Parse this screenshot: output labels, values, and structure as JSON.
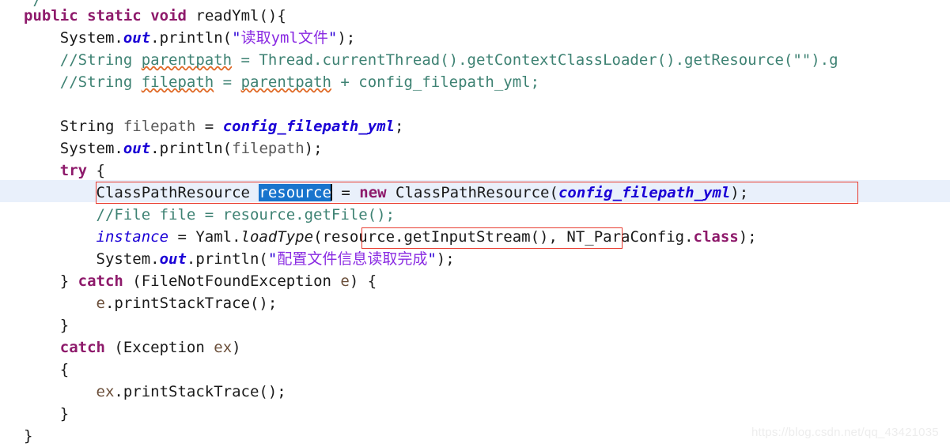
{
  "editor": {
    "language": "Java",
    "font_size_px": 19,
    "line_height_px": 28,
    "background": "#ffffff",
    "current_line_highlight": "#e9f0fb",
    "selection_color": "#1874cd",
    "annotation_box_color": "#e83b2f",
    "colors": {
      "keyword": "#8e1a6b",
      "comment": "#3e8273",
      "string_quote": "#2b00d6",
      "string_text": "#8a2be2",
      "static_field": "#1a00d6",
      "local_var": "#6b4f3a",
      "plain_text": "#1a1a1a",
      "spellcheck_underline": "#e06c2a"
    }
  },
  "code": {
    "line_00_partial": "/",
    "line_01": {
      "kw_public": "public",
      "kw_static": "static",
      "kw_void": "void",
      "method": " readYml(){"
    },
    "line_02": {
      "pre": "System.",
      "out": "out",
      "mid": ".println(",
      "quote": "\"",
      "string": "读取yml文件",
      "post": ");"
    },
    "line_03": {
      "a": "//String ",
      "sq": "parentpath",
      "b": " = Thread.currentThread().getContextClassLoader().getResource(\"\").g"
    },
    "line_04": {
      "a": "//String ",
      "sq1": "filepath",
      "b": " = ",
      "sq2": "parentpath",
      "c": " + config_filepath_yml;"
    },
    "line_05": "",
    "line_06": {
      "a": "String ",
      "var": "filepath",
      "b": " = ",
      "field": "config_filepath_yml",
      "c": ";"
    },
    "line_07": {
      "pre": "System.",
      "out": "out",
      "mid": ".println(",
      "var": "filepath",
      "post": ");"
    },
    "line_08": {
      "kw": "try",
      "rest": " {"
    },
    "line_09": {
      "type": "ClassPathResource ",
      "selected_var": "resource",
      "eq": " = ",
      "kw_new": "new",
      "ctor": " ClassPathResource(",
      "arg": "config_filepath_yml",
      "end": ");"
    },
    "line_10": "//File file = resource.getFile();",
    "line_11": {
      "field": "instance",
      "eq": " = Yaml.",
      "method": "loadType",
      "open": "(",
      "boxed": "resource.getInputStream()",
      "mid": ", NT_ParaConfig.",
      "kw_class": "class",
      "end": ");"
    },
    "line_12": {
      "pre": "System.",
      "out": "out",
      "mid": ".println(",
      "quote": "\"",
      "string": "配置文件信息读取完成",
      "post": ");"
    },
    "line_13": {
      "brace": "} ",
      "kw": "catch",
      "a": " (FileNotFoundException ",
      "var": "e",
      "b": ") {"
    },
    "line_14": {
      "var": "e",
      "rest": ".printStackTrace();"
    },
    "line_15": "}",
    "line_16": {
      "kw": "catch",
      "a": " (Exception ",
      "var": "ex",
      "b": ")"
    },
    "line_17": "{",
    "line_18": {
      "var": "ex",
      "rest": ".printStackTrace();"
    },
    "line_19": "}",
    "line_20": "}"
  },
  "annotations": {
    "box_1_label": "highlight-classpathresource-line",
    "box_2_label": "highlight-resource-getinputstream"
  },
  "watermark": {
    "text": "https://blog.csdn.net/qq_43421035"
  }
}
